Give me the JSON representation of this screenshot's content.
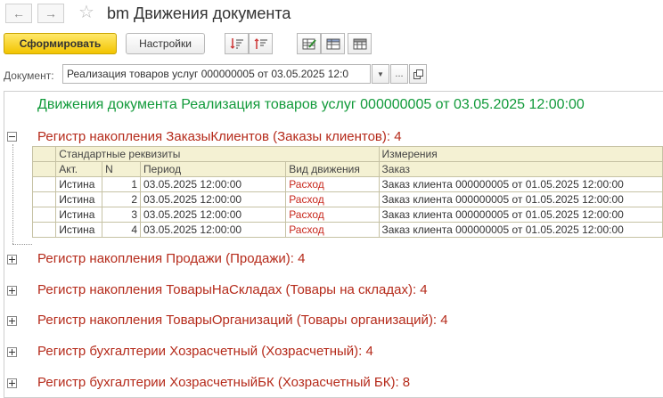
{
  "window": {
    "back_icon": "arrow-left-icon",
    "forward_icon": "arrow-right-icon",
    "favorite_icon": "star-icon",
    "title": "bm Движения документа"
  },
  "toolbar": {
    "generate_label": "Сформировать",
    "settings_label": "Настройки"
  },
  "document": {
    "label": "Документ:",
    "value": "Реализация товаров услуг 000000005 от 03.05.2025 12:0",
    "dropdown_icon": "dropdown-arrow-icon",
    "select_label": "...",
    "open_icon": "open-link-icon"
  },
  "report": {
    "title": "Движения документа Реализация товаров услуг 000000005 от 03.05.2025 12:00:00",
    "sections": [
      {
        "title": "Регистр накопления ЗаказыКлиентов (Заказы клиентов): 4",
        "expanded": true
      },
      {
        "title": "Регистр накопления Продажи (Продажи): 4",
        "expanded": false
      },
      {
        "title": "Регистр накопления ТоварыНаСкладах (Товары на складах): 4",
        "expanded": false
      },
      {
        "title": "Регистр накопления ТоварыОрганизаций (Товары организаций): 4",
        "expanded": false
      },
      {
        "title": "Регистр бухгалтерии Хозрасчетный (Хозрасчетный): 4",
        "expanded": false
      },
      {
        "title": "Регистр бухгалтерии ХозрасчетныйБК (Хозрасчетный БК): 8",
        "expanded": false
      }
    ],
    "table": {
      "group_standard": "Стандартные реквизиты",
      "group_dimensions": "Измерения",
      "columns": [
        "Акт.",
        "N",
        "Период",
        "Вид движения",
        "Заказ"
      ],
      "rows": [
        [
          "Истина",
          "1",
          "03.05.2025 12:00:00",
          "Расход",
          "Заказ клиента 000000005 от 01.05.2025 12:00:00"
        ],
        [
          "Истина",
          "2",
          "03.05.2025 12:00:00",
          "Расход",
          "Заказ клиента 000000005 от 01.05.2025 12:00:00"
        ],
        [
          "Истина",
          "3",
          "03.05.2025 12:00:00",
          "Расход",
          "Заказ клиента 000000005 от 01.05.2025 12:00:00"
        ],
        [
          "Истина",
          "4",
          "03.05.2025 12:00:00",
          "Расход",
          "Заказ клиента 000000005 от 01.05.2025 12:00:00"
        ]
      ]
    }
  },
  "colors": {
    "title_green": "#119a3a",
    "section_red": "#b52a1a",
    "movement_red": "#c8281c",
    "table_header_bg": "#f4f1d3",
    "primary_button": "#f2c400"
  }
}
